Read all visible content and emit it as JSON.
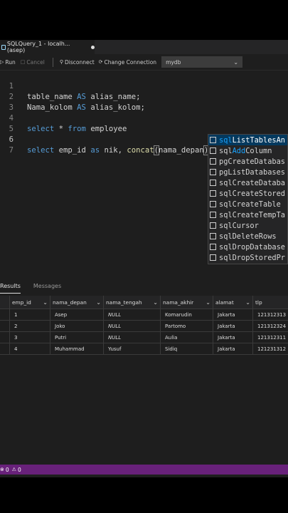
{
  "tab": {
    "title": "SQLQuery_1 - localh... (asep)"
  },
  "toolbar": {
    "run": "Run",
    "cancel": "Cancel",
    "disconnect": "Disconnect",
    "change_connection": "Change Connection",
    "database": "mydb"
  },
  "editor": {
    "line_numbers": [
      "1",
      "2",
      "3",
      "4",
      "5",
      "6",
      "7"
    ],
    "l1": {
      "a": "table_name ",
      "b": "AS",
      "c": " alias_name;"
    },
    "l2": {
      "a": "Nama_kolom ",
      "b": "AS",
      "c": " alias_kolom;"
    },
    "l4": {
      "a": "select",
      "b": " * ",
      "c": "from",
      "d": " employee"
    },
    "l6": {
      "a": "select",
      "b": " emp_id ",
      "c": "as",
      "d": " nik, ",
      "e": "concat",
      "f": "(",
      "g": "nama_depan",
      "h": ")"
    }
  },
  "suggestions": [
    {
      "pre": "",
      "hl": "sql",
      "post": "ListTablesAn"
    },
    {
      "pre": "sql",
      "hl": "Add",
      "post": "Column"
    },
    {
      "pre": "",
      "hl": "",
      "post": "pgCreateDatabas"
    },
    {
      "pre": "",
      "hl": "",
      "post": "pgListDatabases"
    },
    {
      "pre": "",
      "hl": "",
      "post": "sqlCreateDataba"
    },
    {
      "pre": "",
      "hl": "",
      "post": "sqlCreateStored"
    },
    {
      "pre": "",
      "hl": "",
      "post": "sqlCreateTable"
    },
    {
      "pre": "",
      "hl": "",
      "post": "sqlCreateTempTa"
    },
    {
      "pre": "",
      "hl": "",
      "post": "sqlCursor"
    },
    {
      "pre": "",
      "hl": "",
      "post": "sqlDeleteRows"
    },
    {
      "pre": "",
      "hl": "",
      "post": "sqlDropDatabase"
    },
    {
      "pre": "",
      "hl": "",
      "post": "sqlDropStoredPr"
    }
  ],
  "results": {
    "tab_results": "Results",
    "tab_messages": "Messages",
    "columns": [
      "emp_id",
      "nama_depan",
      "nama_tengah",
      "nama_akhir",
      "alamat",
      "tlp"
    ],
    "rows": [
      [
        "1",
        "Asep",
        "NULL",
        "Komarudin",
        "Jakarta",
        "121312313"
      ],
      [
        "2",
        "Joko",
        "NULL",
        "Partomo",
        "Jakarta",
        "121312324"
      ],
      [
        "3",
        "Putri",
        "NULL",
        "Aulia",
        "Jakarta",
        "121312311"
      ],
      [
        "4",
        "Muhammad",
        "Yusuf",
        "Sidiq",
        "Jakarta",
        "121231312"
      ]
    ]
  },
  "status": {
    "errors": "0",
    "warnings": "0"
  }
}
